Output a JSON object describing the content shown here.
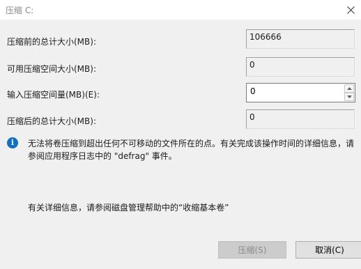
{
  "window": {
    "title": "压缩 C:"
  },
  "rows": [
    {
      "label": "压缩前的总计大小(MB):",
      "value": "106666"
    },
    {
      "label": "可用压缩空间大小(MB):",
      "value": "0"
    },
    {
      "label": "输入压缩空间量(MB)(E):",
      "value": "0"
    },
    {
      "label": "压缩后的总计大小(MB):",
      "value": "0"
    }
  ],
  "info": {
    "text": "无法将卷压缩到超出任何不可移动的文件所在的点。有关完成该操作时间的详细信息，请参阅应用程序日志中的 \"defrag\" 事件。",
    "icon": "info-icon"
  },
  "more_info": "有关详细信息，请参阅磁盘管理帮助中的“收缩基本卷”",
  "buttons": {
    "shrink": "压缩(S)",
    "cancel": "取消(C)"
  },
  "colors": {
    "accent": "#0e6fc7",
    "background": "#f0f0f0"
  }
}
